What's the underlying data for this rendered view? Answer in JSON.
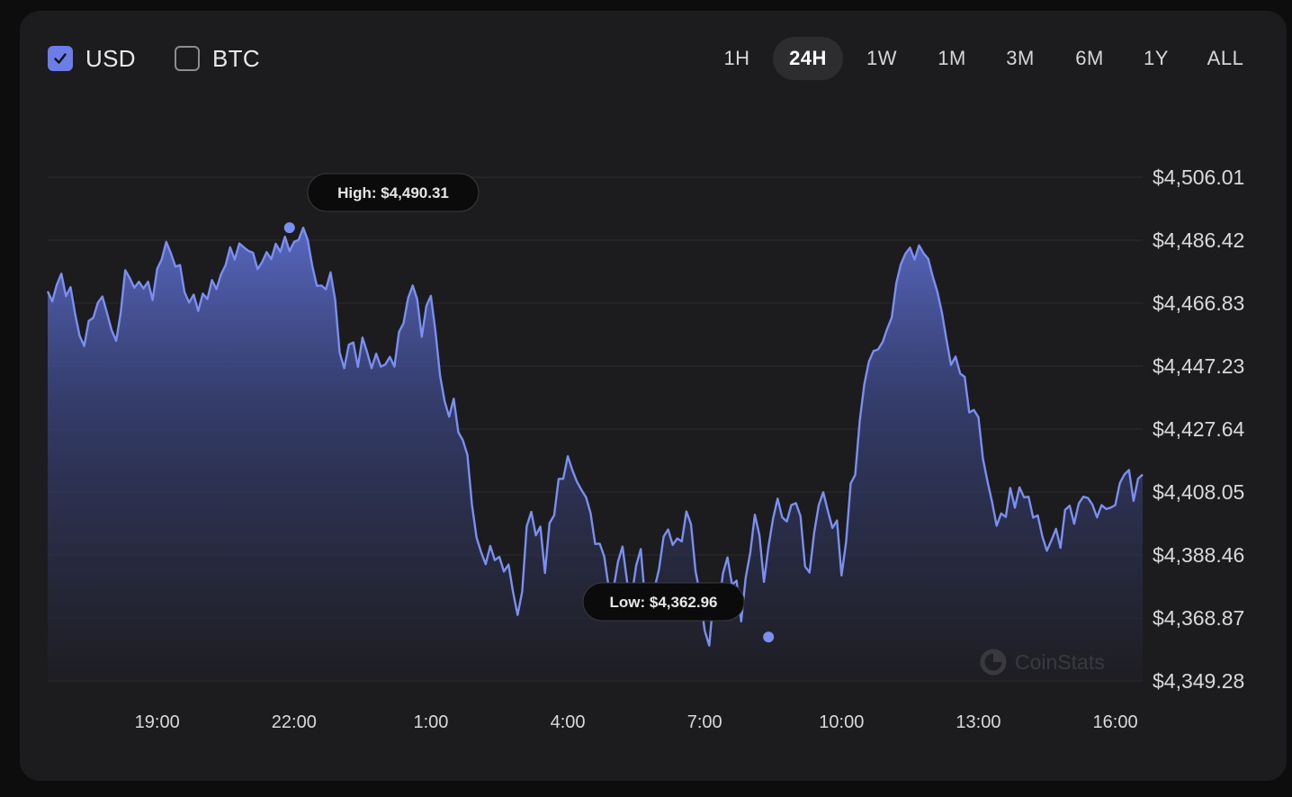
{
  "currency_toggles": [
    {
      "label": "USD",
      "checked": true
    },
    {
      "label": "BTC",
      "checked": false
    }
  ],
  "time_ranges": [
    {
      "label": "1H",
      "active": false
    },
    {
      "label": "24H",
      "active": true
    },
    {
      "label": "1W",
      "active": false
    },
    {
      "label": "1M",
      "active": false
    },
    {
      "label": "3M",
      "active": false
    },
    {
      "label": "6M",
      "active": false
    },
    {
      "label": "1Y",
      "active": false
    },
    {
      "label": "ALL",
      "active": false
    }
  ],
  "colors": {
    "accent": "#6b7de6",
    "line": "#7b8ff0",
    "background": "#1c1c1e",
    "grid": "#2c2c2f"
  },
  "watermark": "CoinStats",
  "icons": {
    "check": "check-icon",
    "watermark_logo": "coinstats-logo-icon"
  },
  "chart_data": {
    "type": "area",
    "title": "",
    "xlabel": "",
    "ylabel": "",
    "ylim": [
      4349.28,
      4506.01
    ],
    "yticks": [
      "$4,506.01",
      "$4,486.42",
      "$4,466.83",
      "$4,447.23",
      "$4,427.64",
      "$4,408.05",
      "$4,388.46",
      "$4,368.87",
      "$4,349.28"
    ],
    "xticks": [
      "19:00",
      "22:00",
      "1:00",
      "4:00",
      "7:00",
      "10:00",
      "13:00",
      "16:00"
    ],
    "x_domain_hours": [
      16.6,
      40.6
    ],
    "grid": true,
    "legend": "none",
    "high": {
      "label": "High: $4,490.31",
      "value": 4490.31,
      "x_hour": 21.9
    },
    "low": {
      "label": "Low: $4,362.96",
      "value": 4362.96,
      "x_hour": 32.4
    },
    "series": [
      {
        "x_start_hour": 16.6,
        "x_step_hour": 0.1,
        "values": [
          4470.5,
          4467.4,
          4472.5,
          4476.0,
          4469.0,
          4471.8,
          4463.6,
          4456.7,
          4453.5,
          4461.3,
          4462.3,
          4467.0,
          4468.9,
          4463.8,
          4458.5,
          4455.1,
          4463.7,
          4477.1,
          4474.6,
          4471.6,
          4473.5,
          4471.4,
          4473.5,
          4467.8,
          4477.5,
          4480.5,
          4485.9,
          4482.4,
          4478.2,
          4478.7,
          4470.2,
          4467.0,
          4469.5,
          4464.4,
          4469.8,
          4468.1,
          4474.0,
          4471.2,
          4475.8,
          4478.7,
          4484.2,
          4480.4,
          4485.4,
          4484.2,
          4483.1,
          4482.5,
          4477.4,
          4479.6,
          4482.7,
          4480.5,
          4485.3,
          4482.8,
          4487.5,
          4483.0,
          4485.9,
          4486.5,
          4490.3,
          4486.5,
          4478.4,
          4472.2,
          4472.3,
          4471.1,
          4476.4,
          4467.9,
          4451.5,
          4446.6,
          4453.9,
          4454.6,
          4447.0,
          4456.1,
          4451.6,
          4446.6,
          4451.1,
          4447.1,
          4447.7,
          4450.1,
          4447.1,
          4457.9,
          4460.6,
          4468.4,
          4472.3,
          4468.0,
          4456.4,
          4466.0,
          4469.1,
          4458.0,
          4444.3,
          4436.3,
          4431.5,
          4437.1,
          4426.7,
          4424.2,
          4419.6,
          4404.0,
          4393.9,
          4389.4,
          4385.6,
          4391.3,
          4386.9,
          4387.9,
          4383.3,
          4385.5,
          4377.0,
          4369.8,
          4377.1,
          4397.4,
          4401.9,
          4394.6,
          4397.3,
          4382.9,
          4398.4,
          4400.8,
          4412.1,
          4412.2,
          4419.2,
          4414.9,
          4411.3,
          4408.7,
          4406.4,
          4401.5,
          4391.9,
          4392.0,
          4388.0,
          4378.1,
          4377.8,
          4386.4,
          4391.1,
          4380.2,
          4375.7,
          4385.2,
          4390.3,
          4373.1,
          4378.8,
          4378.0,
          4384.1,
          4394.2,
          4396.4,
          4391.6,
          4393.6,
          4392.7,
          4402.0,
          4398.1,
          4383.4,
          4376.2,
          4365.0,
          4360.3,
          4376.0,
          4371.0,
          4382.7,
          4387.7,
          4379.2,
          4380.5,
          4367.8,
          4381.4,
          4389.2,
          4401.0,
          4394.6,
          4380.1,
          4391.2,
          4399.9,
          4406.0,
          4400.2,
          4398.9,
          4404.0,
          4404.6,
          4400.6,
          4384.9,
          4383.0,
          4395.4,
          4404.0,
          4408.0,
          4402.2,
          4396.9,
          4399.2,
          4382.1,
          4392.5,
          4410.7,
          4413.4,
          4430.3,
          4441.7,
          4448.7,
          4451.9,
          4452.4,
          4454.7,
          4458.8,
          4462.3,
          4473.0,
          4478.9,
          4482.2,
          4484.1,
          4480.4,
          4484.8,
          4482.3,
          4480.6,
          4475.1,
          4470.4,
          4463.9,
          4455.4,
          4447.6,
          4450.2,
          4444.9,
          4443.9,
          4432.8,
          4433.6,
          4431.3,
          4418.4,
          4411.3,
          4404.9,
          4397.6,
          4401.4,
          4400.3,
          4409.3,
          4403.2,
          4409.5,
          4406.4,
          4406.6,
          4400.1,
          4400.8,
          4394.4,
          4389.8,
          4393.0,
          4396.6,
          4390.7,
          4402.5,
          4403.8,
          4398.2,
          4404.5,
          4406.6,
          4406.2,
          4404.1,
          4400.2,
          4404.0,
          4402.8,
          4403.2,
          4404.0,
          4410.8,
          4413.5,
          4414.9,
          4405.3,
          4412.2,
          4413.5
        ]
      }
    ]
  }
}
